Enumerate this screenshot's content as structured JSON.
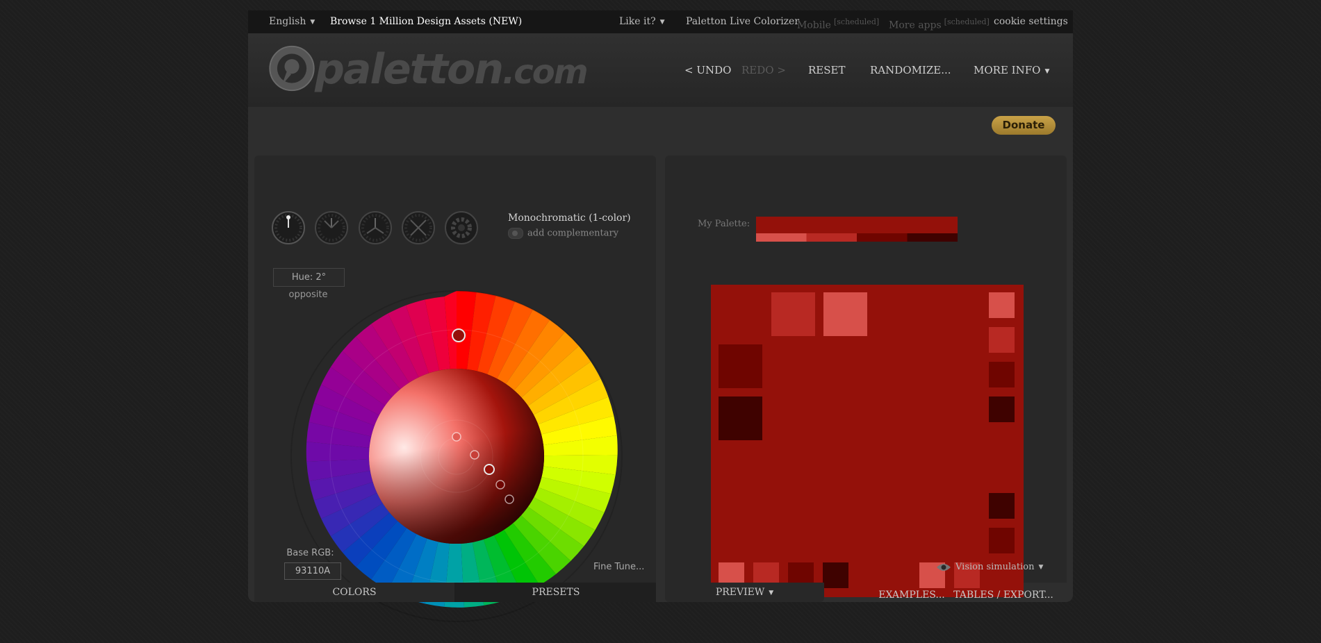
{
  "topbar": {
    "language": "English",
    "browse": "Browse 1 Million Design Assets (NEW)",
    "like_it": "Like it?",
    "colorizer": "Paletton Live Colorizer",
    "mobile": "Mobile",
    "mobile_tag": "[scheduled]",
    "more_apps": "More apps",
    "more_apps_tag": "[scheduled]",
    "cookie": "cookie settings"
  },
  "header": {
    "logo_text": "paletton",
    "logo_suffix": ".com",
    "undo": "< UNDO",
    "redo": "REDO >",
    "reset": "RESET",
    "randomize": "RANDOMIZE...",
    "more_info": "MORE INFO"
  },
  "donate": "Donate",
  "colors_panel": {
    "scheme_label": "Monochromatic (1-color)",
    "add_complementary": "add complementary",
    "hue": "Hue: 2°",
    "opposite": "opposite",
    "base_rgb_label": "Base RGB:",
    "base_rgb": "93110A",
    "fine_tune": "Fine Tune..."
  },
  "tabs_left": {
    "colors": "COLORS",
    "presets": "PRESETS"
  },
  "preview_panel": {
    "my_palette_label": "My Palette:",
    "palette_main": "#94110a",
    "palette_shades": [
      "#d7504a",
      "#b82923",
      "#6f0500",
      "#3f0200"
    ],
    "vision_simulation": "Vision simulation"
  },
  "tabs_right": {
    "preview": "PREVIEW",
    "examples": "EXAMPLES...",
    "tables": "TABLES / EXPORT..."
  },
  "colors": {
    "base": "#94110a",
    "light1": "#d7504a",
    "light2": "#b82923",
    "dark1": "#6f0500",
    "dark2": "#3f0200"
  }
}
